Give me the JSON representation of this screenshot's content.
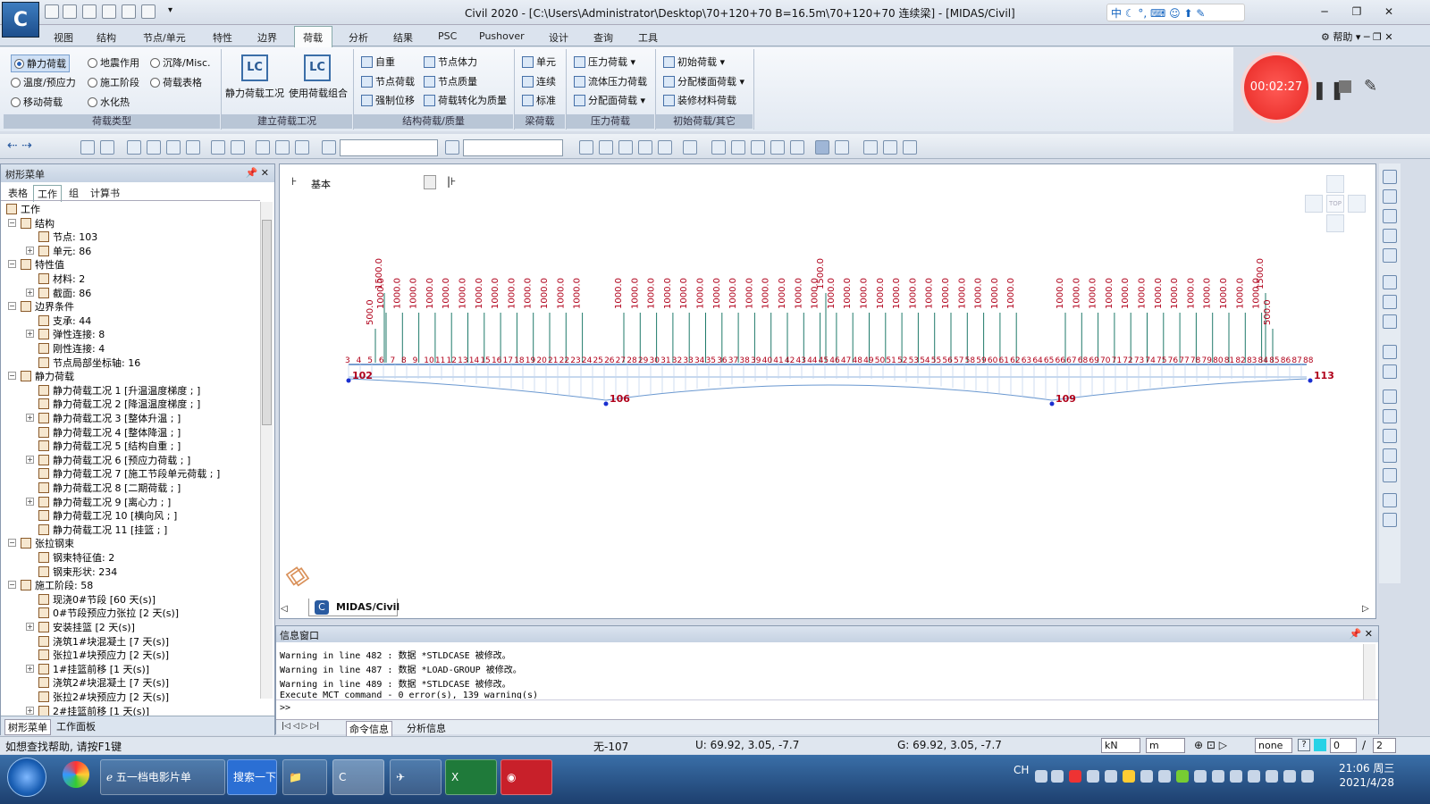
{
  "titlebar": {
    "app_logo": "C",
    "title": "Civil 2020 - [C:\\Users\\Administrator\\Desktop\\70+120+70   B=16.5m\\70+120+70 连续梁] - [MIDAS/Civil]",
    "ime": "中",
    "help": "帮助"
  },
  "menu": [
    "视图",
    "结构",
    "节点/单元",
    "特性",
    "边界",
    "荷载",
    "分析",
    "结果",
    "PSC",
    "Pushover",
    "设计",
    "查询",
    "工具"
  ],
  "menu_active": "荷载",
  "ribbon": {
    "load_type": {
      "label": "荷载类型",
      "options": [
        "静力荷载",
        "地震作用",
        "沉降/Misc.",
        "温度/预应力",
        "施工阶段",
        "荷载表格",
        "移动荷载",
        "水化热"
      ],
      "selected": "静力荷载"
    },
    "build_cases": {
      "label": "建立荷载工况",
      "buttons": [
        "静力荷载工况",
        "使用荷载组合"
      ],
      "icon_text": [
        "LC",
        "LC"
      ]
    },
    "struct_load": {
      "label": "结构荷载/质量",
      "items": [
        "自重",
        "节点体力",
        "节点荷载",
        "节点质量",
        "强制位移",
        "荷载转化为质量"
      ]
    },
    "beam_load": {
      "label": "梁荷载",
      "items": [
        "单元",
        "连续",
        "标准"
      ]
    },
    "pressure": {
      "label": "压力荷载",
      "items": [
        "压力荷载",
        "流体压力荷载",
        "分配面荷载"
      ]
    },
    "initial": {
      "label": "初始荷载/其它",
      "items": [
        "初始荷载",
        "分配楼面荷载",
        "装修材料荷载"
      ]
    }
  },
  "recorder": {
    "time": "00:02:27"
  },
  "tree": {
    "title": "树形菜单",
    "tabs": [
      "表格",
      "工作",
      "组",
      "计算书"
    ],
    "active_tab": "工作",
    "nodes": [
      {
        "text": "工作",
        "level": 0
      },
      {
        "text": "结构",
        "level": 1
      },
      {
        "text": "节点: 103",
        "level": 2
      },
      {
        "text": "单元: 86",
        "level": 2
      },
      {
        "text": "特性值",
        "level": 1
      },
      {
        "text": "材料: 2",
        "level": 2
      },
      {
        "text": "截面: 86",
        "level": 2
      },
      {
        "text": "边界条件",
        "level": 1
      },
      {
        "text": "支承: 44",
        "level": 2
      },
      {
        "text": "弹性连接: 8",
        "level": 2
      },
      {
        "text": "刚性连接: 4",
        "level": 2
      },
      {
        "text": "节点局部坐标轴: 16",
        "level": 2
      },
      {
        "text": "静力荷载",
        "level": 1
      },
      {
        "text": "静力荷载工况 1 [升温温度梯度 ; ]",
        "level": 2
      },
      {
        "text": "静力荷载工况 2 [降温温度梯度 ; ]",
        "level": 2
      },
      {
        "text": "静力荷载工况 3 [整体升温 ; ]",
        "level": 2
      },
      {
        "text": "静力荷载工况 4 [整体降温 ; ]",
        "level": 2
      },
      {
        "text": "静力荷载工况 5 [结构自重 ; ]",
        "level": 2
      },
      {
        "text": "静力荷载工况 6 [预应力荷载 ; ]",
        "level": 2
      },
      {
        "text": "静力荷载工况 7 [施工节段单元荷载 ; ]",
        "level": 2
      },
      {
        "text": "静力荷载工况 8 [二期荷载 ; ]",
        "level": 2
      },
      {
        "text": "静力荷载工况 9 [离心力 ; ]",
        "level": 2
      },
      {
        "text": "静力荷载工况 10 [横向风 ; ]",
        "level": 2
      },
      {
        "text": "静力荷载工况 11 [挂篮 ; ]",
        "level": 2
      },
      {
        "text": "张拉钢束",
        "level": 1
      },
      {
        "text": "钢束特征值: 2",
        "level": 2
      },
      {
        "text": "钢束形状: 234",
        "level": 2
      },
      {
        "text": "施工阶段: 58",
        "level": 1
      },
      {
        "text": "现浇0#节段 [60 天(s)]",
        "level": 2
      },
      {
        "text": "0#节段预应力张拉 [2 天(s)]",
        "level": 2
      },
      {
        "text": "安装挂篮 [2 天(s)]",
        "level": 2
      },
      {
        "text": "浇筑1#块混凝土 [7 天(s)]",
        "level": 2
      },
      {
        "text": "张拉1#块预应力 [2 天(s)]",
        "level": 2
      },
      {
        "text": "1#挂篮前移 [1 天(s)]",
        "level": 2
      },
      {
        "text": "浇筑2#块混凝土 [7 天(s)]",
        "level": 2
      },
      {
        "text": "张拉2#块预应力 [2 天(s)]",
        "level": 2
      },
      {
        "text": "2#挂篮前移 [1 天(s)]",
        "level": 2
      }
    ],
    "bottom_tabs": [
      "树形菜单",
      "工作面板"
    ]
  },
  "view": {
    "label": "基本",
    "tab": "MIDAS/Civil"
  },
  "model": {
    "load_value": "1000.0",
    "peak_value": "1500.0",
    "small_value": "500.0",
    "support_labels": [
      "102",
      "106",
      "109",
      "113"
    ]
  },
  "messages": {
    "title": "信息窗口",
    "lines": [
      "Warning in line 482 : 数据 *STLDCASE 被修改。",
      "Warning in line 487 : 数据 *LOAD-GROUP 被修改。",
      "Warning in line 489 : 数据 *STLDCASE 被修改。",
      "Execute MCT command - 0 error(s), 139 warning(s)"
    ],
    "prompt": ">>",
    "tabs": [
      "命令信息",
      "分析信息"
    ]
  },
  "status": {
    "help": "如想查找帮助, 请按F1键",
    "node": "无-107",
    "u": "U: 69.92, 3.05, -7.7",
    "g": "G: 69.92, 3.05, -7.7",
    "force_unit": "kN",
    "length_unit": "m",
    "none": "none",
    "page": "0",
    "page_total": "2"
  },
  "taskbar": {
    "items": [
      "五一档电影片单",
      "搜索一下"
    ],
    "time": "21:06 周三",
    "date": "2021/4/28",
    "lang": "CH"
  }
}
